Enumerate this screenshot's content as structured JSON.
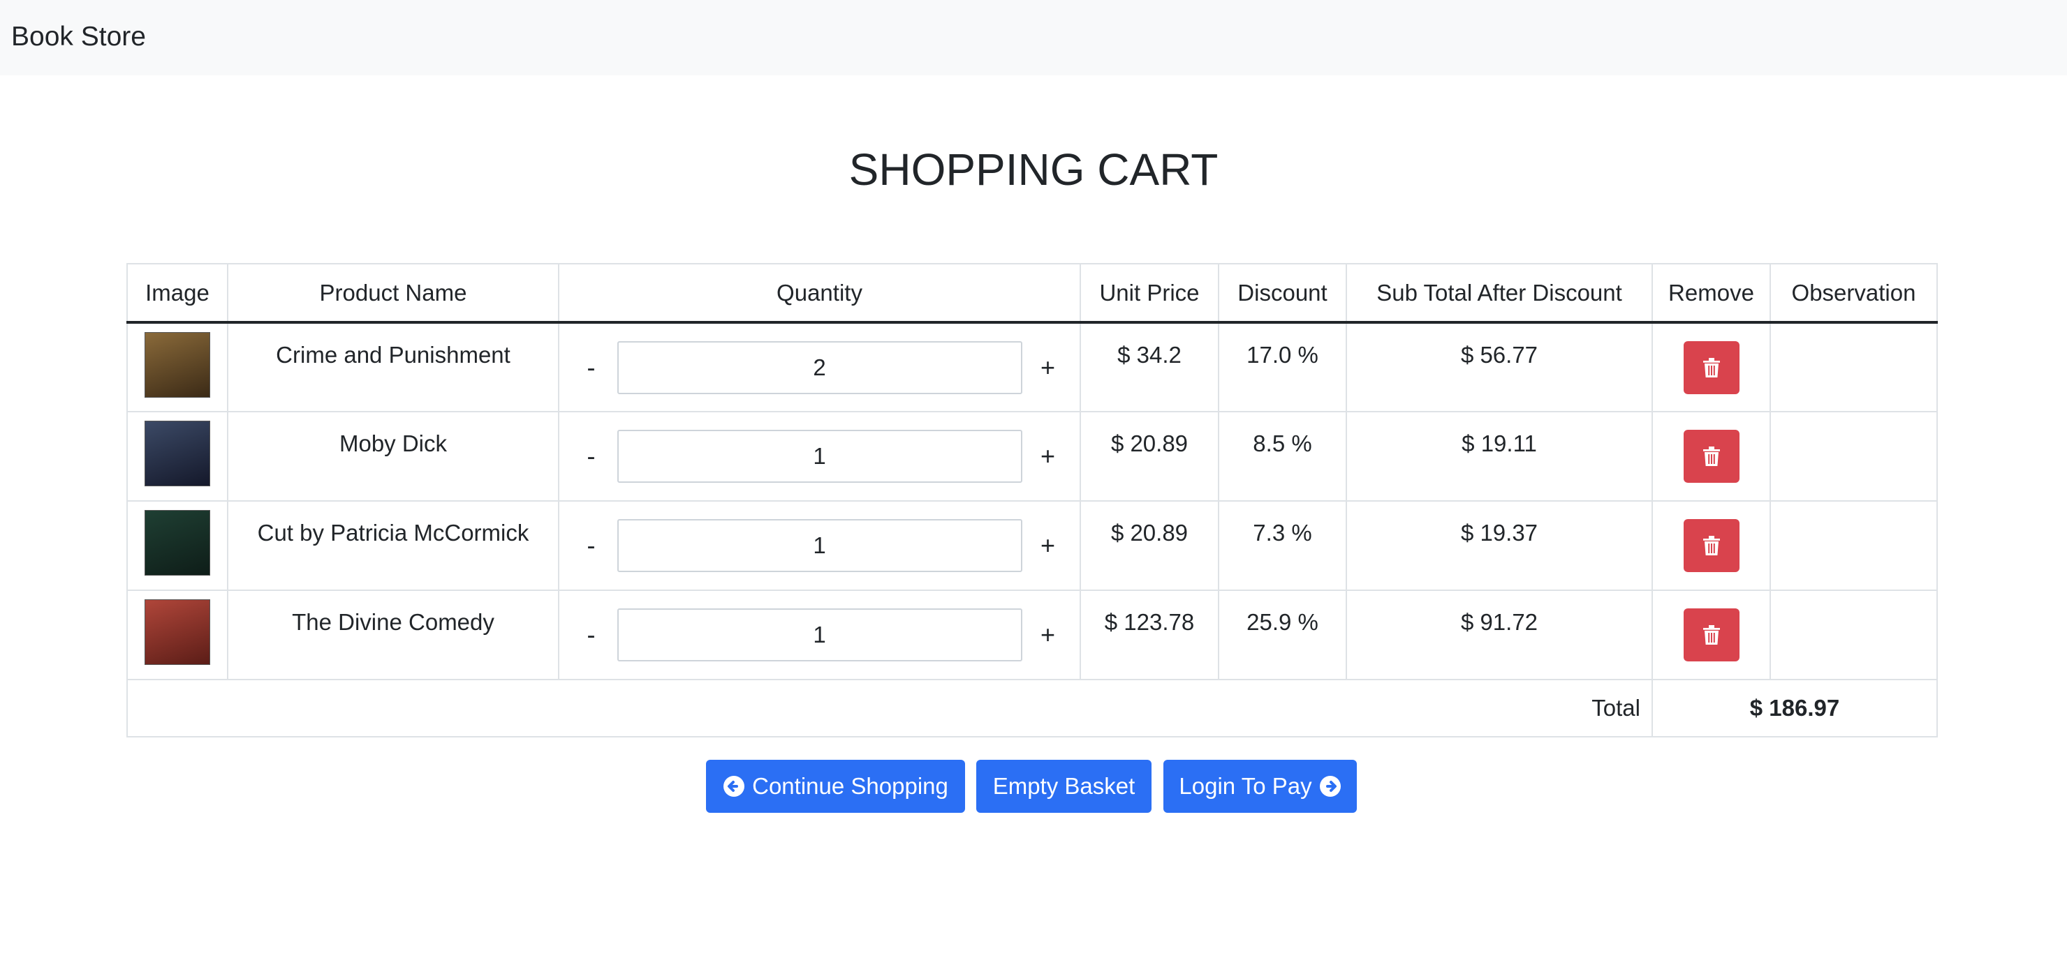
{
  "navbar": {
    "brand": "Book Store"
  },
  "page": {
    "title": "SHOPPING CART"
  },
  "cart": {
    "headers": {
      "image": "Image",
      "product_name": "Product Name",
      "quantity": "Quantity",
      "unit_price": "Unit Price",
      "discount": "Discount",
      "subtotal": "Sub Total After Discount",
      "remove": "Remove",
      "observation": "Observation"
    },
    "items": [
      {
        "name": "Crime and Punishment",
        "quantity": "2",
        "unit_price": "$ 34.2",
        "discount": "17.0 %",
        "subtotal": "$ 56.77",
        "observation": "",
        "minus": "-",
        "plus": "+",
        "cover_colors": [
          "#8a6a3a",
          "#3b2a16"
        ]
      },
      {
        "name": "Moby Dick",
        "quantity": "1",
        "unit_price": "$ 20.89",
        "discount": "8.5 %",
        "subtotal": "$ 19.11",
        "observation": "",
        "minus": "-",
        "plus": "+",
        "cover_colors": [
          "#3c4a66",
          "#14182a"
        ]
      },
      {
        "name": "Cut by Patricia McCormick",
        "quantity": "1",
        "unit_price": "$ 20.89",
        "discount": "7.3 %",
        "subtotal": "$ 19.37",
        "observation": "",
        "minus": "-",
        "plus": "+",
        "cover_colors": [
          "#1f3f33",
          "#0e1d18"
        ]
      },
      {
        "name": "The Divine Comedy",
        "quantity": "1",
        "unit_price": "$ 123.78",
        "discount": "25.9 %",
        "subtotal": "$ 91.72",
        "observation": "",
        "minus": "-",
        "plus": "+",
        "cover_colors": [
          "#b0463a",
          "#5b1d17"
        ]
      }
    ],
    "total_label": "Total",
    "total_value": "$ 186.97"
  },
  "actions": {
    "continue_shopping": "Continue Shopping",
    "empty_basket": "Empty Basket",
    "login_to_pay": "Login To Pay"
  },
  "colors": {
    "primary": "#2b6ff4",
    "danger": "#d9434d",
    "navbar_bg": "#f8f9fa"
  },
  "icons": {
    "remove": "trash-icon",
    "back": "arrow-circle-left-icon",
    "forward": "arrow-circle-right-icon"
  }
}
